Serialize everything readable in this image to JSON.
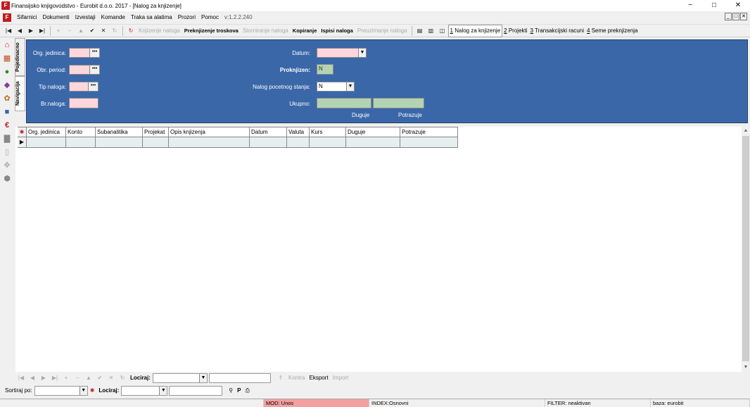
{
  "titlebar": {
    "app_title": "Finansijsko knjigovodstvo - Eurobit d.o.o. 2017 - [Nalog za knjizenje]",
    "minimize": "−",
    "maximize": "□",
    "close": "✕"
  },
  "menubar": {
    "items": [
      "Sifarnici",
      "Dokumenti",
      "Izvestaji",
      "Komande",
      "Traka sa alatima",
      "Prozori",
      "Pomoc"
    ],
    "version": "v:1.2.2.240",
    "mdi": [
      "_",
      "□",
      "✕"
    ]
  },
  "toolbar": {
    "knjizenje": "Knjizenje naloga",
    "preknjizenje": "Preknjizenje troskova",
    "storniranje": "Storniranje naloga",
    "kopiranje": "Kopiranje",
    "ispisi": "Ispisi naloga",
    "preuzimanje": "Preuzimanje naloga",
    "tabs": [
      {
        "num": "1",
        "label": "Nalog za knjizenje"
      },
      {
        "num": "2",
        "label": "Projekti"
      },
      {
        "num": "3",
        "label": "Transakcijski racuni"
      },
      {
        "num": "4",
        "label": "Seme preknjizenja"
      }
    ]
  },
  "vtabs": {
    "pojedinacno": "Pojedinacno",
    "navigacija": "Navigacija"
  },
  "form": {
    "org_jedinica_label": "Org. jedinica:",
    "obr_period_label": "Obr. period:",
    "tip_naloga_label": "Tip naloga:",
    "br_naloga_label": "Br.naloga:",
    "datum_label": "Datum:",
    "proknjizen_label": "Proknjizen:",
    "proknjizen_value": "N",
    "nalog_pocetnog_label": "Nalog pocetnog stanja:",
    "nalog_pocetnog_value": "N",
    "ukupno_label": "Ukupno:",
    "duguje_label": "Duguje",
    "potrazuje_label": "Potrazuje",
    "ellipsis": "•••"
  },
  "grid": {
    "columns": [
      "Org. jedinica",
      "Konto",
      "Subanalitika",
      "Projekat",
      "Opis knjizenja",
      "Datum",
      "Valuta",
      "Kurs",
      "Duguje",
      "Potrazuje"
    ]
  },
  "navbar": {
    "lociraj": "Lociraj:",
    "kontra": "Kontra",
    "eksport": "Eksport",
    "import": "Import"
  },
  "sortbar": {
    "sortiraj": "Sortiraj po:",
    "lociraj": "Lociraj:",
    "p": "P"
  },
  "statusbar": {
    "mod": "MOD: Unos",
    "index": "INDEX:Osnovni",
    "filter": "FILTER: neaktivan",
    "baza": "baza: eurobit"
  },
  "colors": {
    "panel": "#3a67a8",
    "pink": "#ffd6dc",
    "green": "#b3d3b3",
    "mod": "#f4a0a0"
  }
}
